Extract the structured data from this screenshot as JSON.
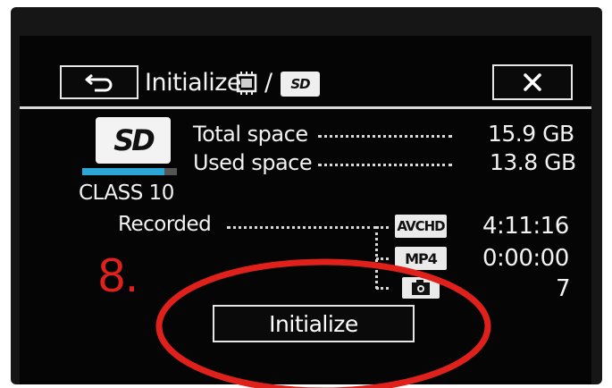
{
  "header": {
    "title": "Initialize",
    "separator": "/",
    "sd_icon_text": "SD"
  },
  "card": {
    "sd_logo_text": "SD",
    "class_label": "CLASS 10",
    "used_fraction": 0.868
  },
  "space": {
    "total_label": "Total space",
    "total_value": "15.9 GB",
    "used_label": "Used space",
    "used_value": "13.8 GB"
  },
  "recorded": {
    "label": "Recorded",
    "items": [
      {
        "format": "AVCHD",
        "value": "4:11:16"
      },
      {
        "format": "MP4",
        "value": "0:00:00"
      },
      {
        "format": "photo-icon",
        "value": "7"
      }
    ]
  },
  "step_label": "8.",
  "initialize_button": "Initialize",
  "colors": {
    "screen": "#050505",
    "text": "#f2f2f2",
    "bar": "#2aa7d6",
    "annotation": "#e0211b"
  }
}
